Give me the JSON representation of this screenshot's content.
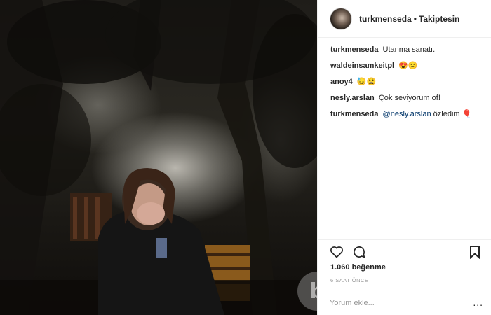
{
  "post": {
    "username": "turkmenseda",
    "separator": "•",
    "follow_status": "Takiptesin"
  },
  "comments": [
    {
      "user": "turkmenseda",
      "text": "Utanma sanatı."
    },
    {
      "user": "waldeinsamkeitpl",
      "text": "😍🙂"
    },
    {
      "user": "anoy4",
      "text": "😓😩"
    },
    {
      "user": "nesly.arslan",
      "text": "Çok seviyorum of!"
    },
    {
      "user": "turkmenseda",
      "mention": "@nesly.arslan",
      "text": "özledim 🎈"
    }
  ],
  "actions": {
    "like_icon": "heart-icon",
    "comment_icon": "comment-icon",
    "save_icon": "bookmark-icon"
  },
  "likes": "1.060 beğenme",
  "time_ago": "6 SAAT ÖNCE",
  "add_comment": {
    "placeholder": "Yorum ekle...",
    "more": "..."
  },
  "watermark": "b"
}
